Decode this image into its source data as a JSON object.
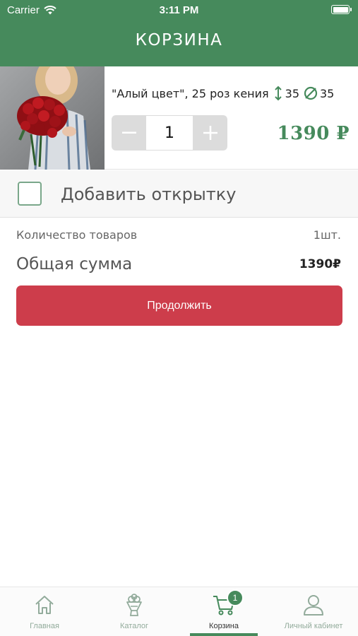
{
  "status_bar": {
    "carrier": "Carrier",
    "time": "3:11 PM"
  },
  "header": {
    "title": "КОРЗИНА"
  },
  "cart_item": {
    "name": "\"Алый цвет\", 25 роз кения",
    "height": "35",
    "diameter": "35",
    "quantity": "1",
    "price": "1390 ₽"
  },
  "add_card": {
    "label": "Добавить открытку",
    "checked": false
  },
  "summary": {
    "items_count_label": "Количество товаров",
    "items_count_value": "1шт.",
    "total_label": "Общая сумма",
    "total_value": "1390₽"
  },
  "continue_button": {
    "label": "Продолжить"
  },
  "tab_bar": {
    "tabs": [
      {
        "label": "Главная",
        "icon": "home-icon"
      },
      {
        "label": "Каталог",
        "icon": "bouquet-icon"
      },
      {
        "label": "Корзина",
        "icon": "cart-icon",
        "active": true,
        "badge": "1"
      },
      {
        "label": "Личный кабинет",
        "icon": "user-icon"
      }
    ]
  },
  "colors": {
    "brand_green": "#468a5c",
    "action_red": "#cd3d4b"
  }
}
